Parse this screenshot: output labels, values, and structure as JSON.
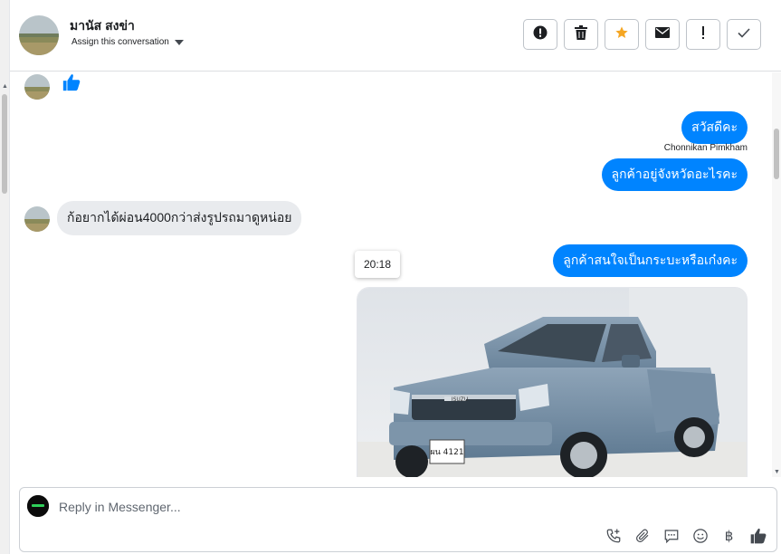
{
  "header": {
    "contact_name": "มานัส สงข่า",
    "assign_label": "Assign this conversation",
    "actions": [
      {
        "name": "spam-icon",
        "glyph": "!"
      },
      {
        "name": "trash-icon",
        "glyph": ""
      },
      {
        "name": "star-icon",
        "glyph": "★"
      },
      {
        "name": "mail-icon",
        "glyph": ""
      },
      {
        "name": "important-icon",
        "glyph": "!"
      },
      {
        "name": "check-icon",
        "glyph": "✓"
      }
    ]
  },
  "conversation": {
    "messages": [
      {
        "direction": "in",
        "type": "like"
      },
      {
        "direction": "out",
        "text": "สวัสดีคะ"
      },
      {
        "direction": "out",
        "sender": "Chonnikan Pimkham",
        "text": "ลูกค้าอยู่จังหวัดอะไรคะ"
      },
      {
        "direction": "in",
        "text": "ก้อยากได้ผ่อน4000กว่าส่งรูปรถมาดูหน่อย"
      },
      {
        "direction": "out",
        "text": "ลูกค้าสนใจเป็นกระบะหรือเก๋งคะ"
      },
      {
        "direction": "out",
        "type": "image",
        "plate_text": "ผน 4121",
        "brand_text": "ISUZU"
      }
    ],
    "timestamp_tooltip": "20:18"
  },
  "composer": {
    "placeholder": "Reply in Messenger...",
    "tools": [
      "call-add-icon",
      "attachment-icon",
      "saved-reply-icon",
      "emoji-icon",
      "baht-icon",
      "like-icon"
    ],
    "baht_glyph": "฿"
  },
  "colors": {
    "accent": "#0084ff",
    "incoming_bubble": "#e9ebee",
    "star": "#f5a623"
  }
}
